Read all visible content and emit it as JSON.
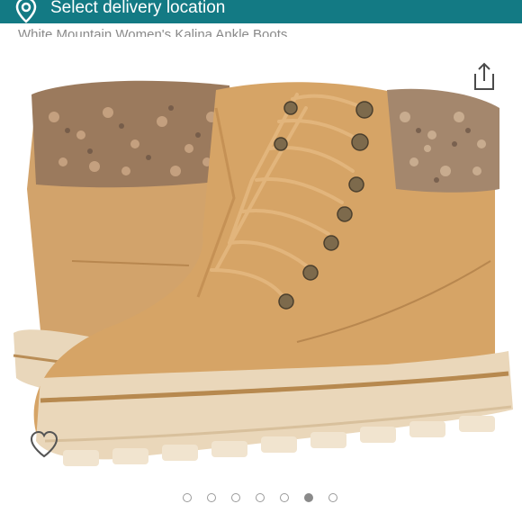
{
  "header": {
    "delivery_label": "Select delivery location",
    "bar_color": "#137a84",
    "location_icon": "location-pin-icon"
  },
  "product": {
    "title": "White Mountain Women's Kalina Ankle Boots",
    "image_subject": "tan suede lace-up ankle boots with knit cuff",
    "share_icon": "share-icon",
    "wishlist_icon": "heart-icon"
  },
  "carousel": {
    "total": 7,
    "active_index": 5
  }
}
